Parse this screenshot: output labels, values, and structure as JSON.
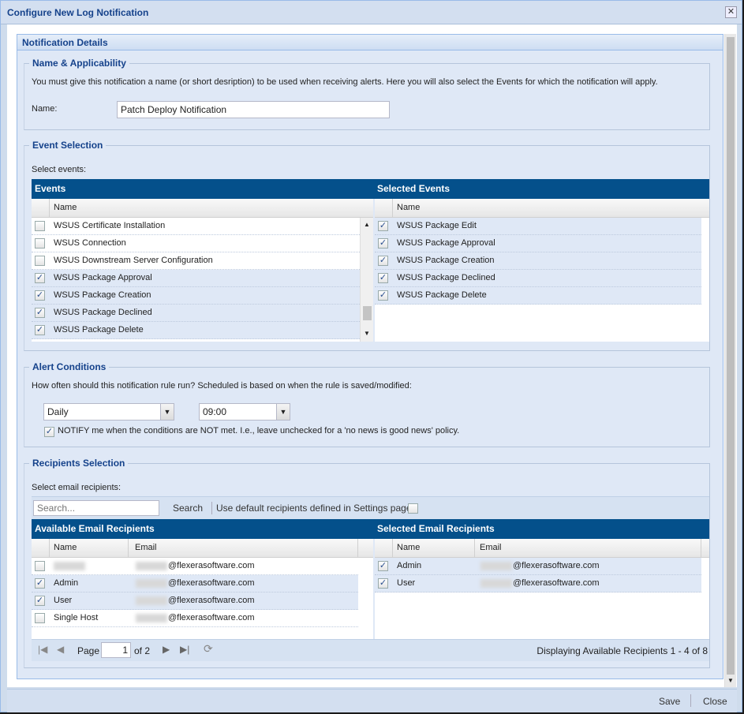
{
  "window": {
    "title": "Configure New Log Notification",
    "close_icon": "close-icon"
  },
  "panel": {
    "title": "Notification Details"
  },
  "name_section": {
    "legend": "Name & Applicability",
    "description": "You must give this notification a name (or short desription) to be used when receiving alerts. Here you will also select the Events for which the notification will apply.",
    "name_label": "Name:",
    "name_value": "Patch Deploy Notification"
  },
  "event_section": {
    "legend": "Event Selection",
    "prompt": "Select events:",
    "events_header": "Events",
    "selected_header": "Selected Events",
    "col_name": "Name",
    "events": [
      {
        "name": "WSUS Certificate Installation",
        "checked": false
      },
      {
        "name": "WSUS Connection",
        "checked": false
      },
      {
        "name": "WSUS Downstream Server Configuration",
        "checked": false
      },
      {
        "name": "WSUS Package Approval",
        "checked": true
      },
      {
        "name": "WSUS Package Creation",
        "checked": true
      },
      {
        "name": "WSUS Package Declined",
        "checked": true
      },
      {
        "name": "WSUS Package Delete",
        "checked": true
      }
    ],
    "selected": [
      {
        "name": "WSUS Package Edit",
        "checked": true
      },
      {
        "name": "WSUS Package Approval",
        "checked": true
      },
      {
        "name": "WSUS Package Creation",
        "checked": true
      },
      {
        "name": "WSUS Package Declined",
        "checked": true
      },
      {
        "name": "WSUS Package Delete",
        "checked": true
      }
    ]
  },
  "alert_section": {
    "legend": "Alert Conditions",
    "question": "How often should this notification rule run? Scheduled is based on when the rule is saved/modified:",
    "frequency": "Daily",
    "time": "09:00",
    "notify_checked": true,
    "notify_label": "NOTIFY me when the conditions are NOT met. I.e., leave unchecked for a 'no news is good news' policy."
  },
  "recipients_section": {
    "legend": "Recipients Selection",
    "prompt": "Select email recipients:",
    "search_placeholder": "Search...",
    "search_button": "Search",
    "default_label": "Use default recipients defined in Settings page:",
    "default_checked": false,
    "available_header": "Available Email Recipients",
    "selected_header": "Selected Email Recipients",
    "col_name": "Name",
    "col_email": "Email",
    "available": [
      {
        "name": "",
        "email": "@flexerasoftware.com",
        "checked": false
      },
      {
        "name": "Admin",
        "email": "@flexerasoftware.com",
        "checked": true
      },
      {
        "name": "User",
        "email": "@flexerasoftware.com",
        "checked": true
      },
      {
        "name": "Single Host",
        "email": "@flexerasoftware.com",
        "checked": false
      }
    ],
    "selected": [
      {
        "name": "Admin",
        "email": "@flexerasoftware.com",
        "checked": true
      },
      {
        "name": "User",
        "email": "@flexerasoftware.com",
        "checked": true
      }
    ],
    "pager": {
      "page_label": "Page",
      "page": "1",
      "of": "of 2",
      "status": "Displaying Available Recipients 1 - 4 of 8"
    }
  },
  "footer": {
    "save": "Save",
    "close": "Close"
  }
}
